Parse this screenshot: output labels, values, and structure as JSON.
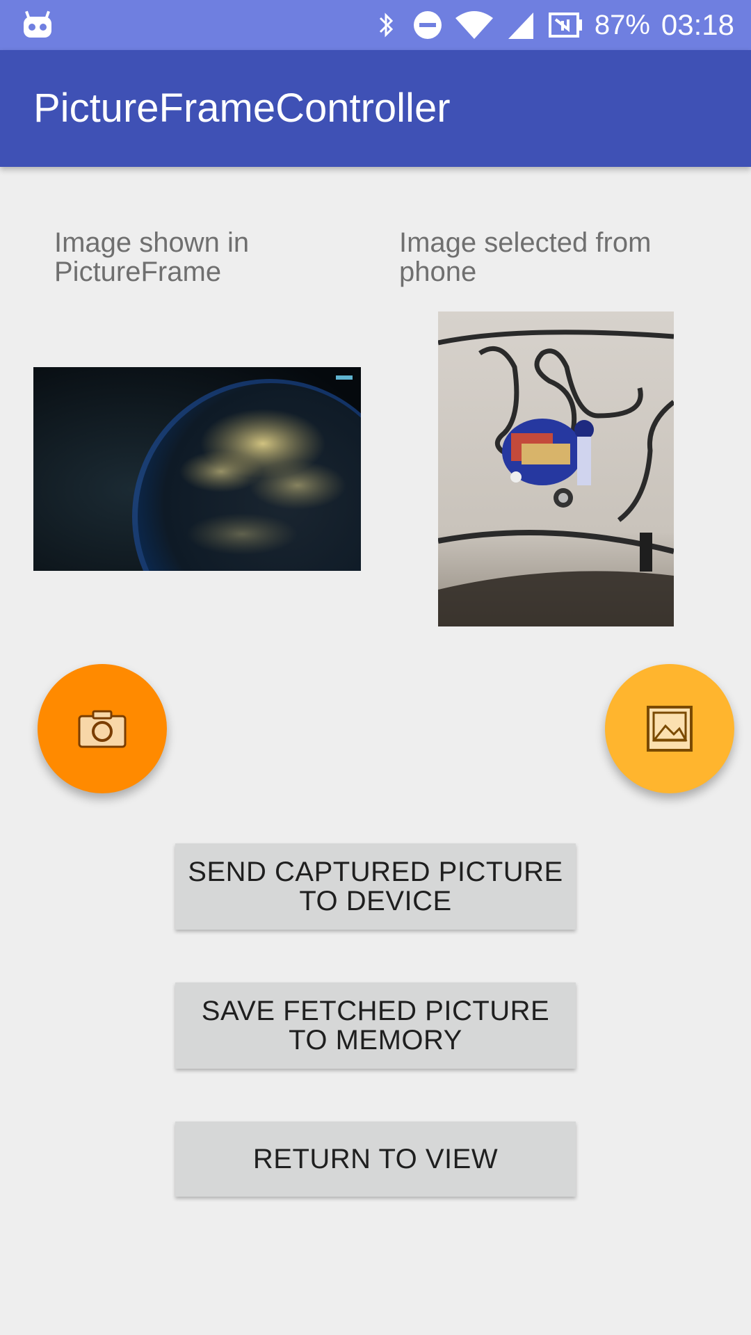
{
  "status_bar": {
    "battery": "87%",
    "time": "03:18",
    "icons": [
      "android-debug-icon",
      "bluetooth-icon",
      "do-not-disturb-icon",
      "wifi-icon",
      "cell-signal-icon",
      "nfc-icon"
    ]
  },
  "app_bar": {
    "title": "PictureFrameController"
  },
  "left_panel": {
    "caption": "Image shown in PictureFrame",
    "image_desc": "Earth at night image"
  },
  "right_panel": {
    "caption": "Image selected from phone",
    "image_desc": "Line-following robot on track photo"
  },
  "fabs": {
    "camera": {
      "icon": "camera-icon",
      "color": "#ff8a00"
    },
    "gallery": {
      "icon": "image-icon",
      "color": "#ffb52e"
    }
  },
  "buttons": {
    "send": "SEND CAPTURED PICTURE TO DEVICE",
    "save": "SAVE FETCHED PICTURE TO MEMORY",
    "return": "RETURN TO VIEW"
  },
  "colors": {
    "status_bar": "#6f7fe0",
    "app_bar": "#3f51b5",
    "background": "#eeeeee",
    "button": "#d6d7d7"
  }
}
